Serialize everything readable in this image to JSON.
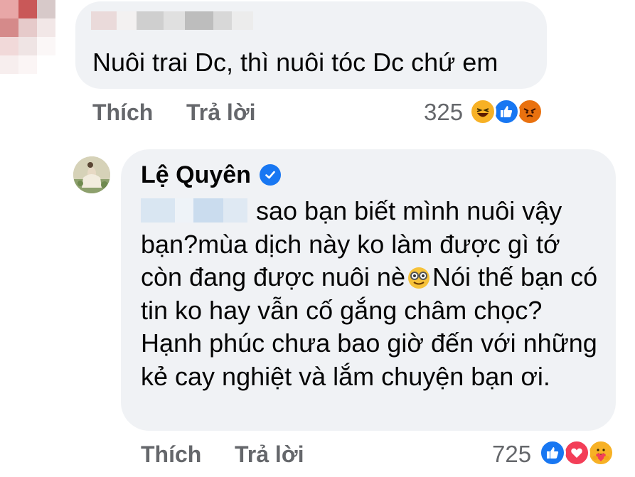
{
  "comment1": {
    "text": "Nuôi trai Dc, thì nuôi tóc Dc chứ em",
    "actions": {
      "like": "Thích",
      "reply": "Trả lời"
    },
    "reaction_count": "325",
    "reactions": [
      "haha-icon",
      "like-icon",
      "angry-icon"
    ]
  },
  "comment2": {
    "author": "Lệ Quyên",
    "verified": true,
    "text_before_emoji": "sao bạn biết mình nuôi vậy bạn?mùa dịch này ko làm được gì tớ còn đang được nuôi nè",
    "emoji": "smiling-face-with-glasses-icon",
    "text_after_emoji": "Nói thế bạn có tin ko hay vẫn cố gắng châm chọc?Hạnh phúc chưa bao giờ đến với những kẻ cay nghiệt và lắm chuyện bạn ơi.",
    "actions": {
      "like": "Thích",
      "reply": "Trả lời"
    },
    "reaction_count": "725",
    "reactions": [
      "like-icon",
      "love-icon",
      "care-icon"
    ]
  },
  "colors": {
    "bubble": "#f0f2f5",
    "secondary_text": "#65676b",
    "verified": "#1877f2",
    "like": "#1877f2",
    "love": "#f33e58",
    "haha": "#f7b125",
    "angry": "#e9710f"
  }
}
